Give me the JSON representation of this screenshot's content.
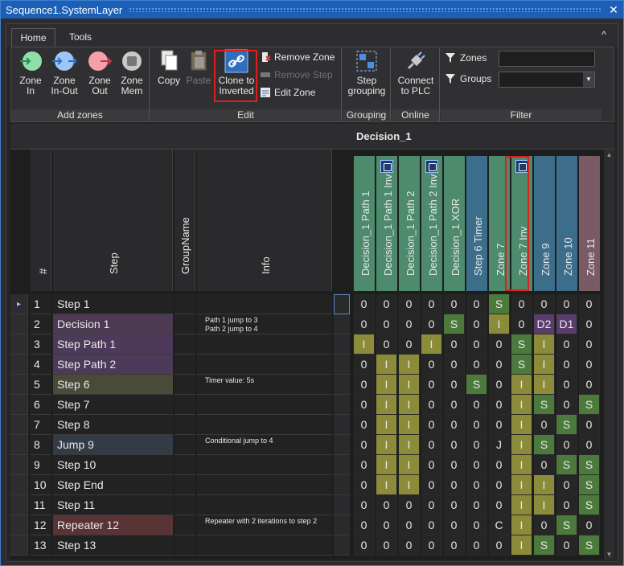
{
  "window": {
    "title": "Sequence1.SystemLayer"
  },
  "tabs": [
    {
      "label": "Home"
    },
    {
      "label": "Tools"
    }
  ],
  "ribbon": {
    "add_zones": {
      "title": "Add zones",
      "buttons": [
        {
          "label": "Zone\nIn",
          "color": "#3cb371"
        },
        {
          "label": "Zone\nIn-Out",
          "color": "#4a90e2"
        },
        {
          "label": "Zone\nOut",
          "color": "#e85d6a"
        },
        {
          "label": "Zone\nMem",
          "color": "#a0a0a0"
        }
      ]
    },
    "edit": {
      "title": "Edit",
      "copy": "Copy",
      "paste": "Paste",
      "clone": "Clone to\nInverted",
      "remove_zone": "Remove Zone",
      "remove_step": "Remove Step",
      "edit_zone": "Edit Zone"
    },
    "grouping": {
      "title": "Grouping",
      "step_grouping": "Step\ngrouping"
    },
    "online": {
      "title": "Online",
      "connect": "Connect\nto PLC"
    },
    "filter": {
      "title": "Filter",
      "zones_label": "Zones",
      "groups_label": "Groups",
      "zones_value": "",
      "groups_value": ""
    }
  },
  "grid": {
    "group_label": "Decision_1",
    "columns": {
      "num": "#",
      "step": "Step",
      "groupname": "GroupName",
      "info": "Info"
    },
    "zones": [
      {
        "name": "Decision_1 Path 1",
        "color": "#4e8a6c",
        "inv": false
      },
      {
        "name": "Decision_1 Path 1 Inv",
        "color": "#4e8a6c",
        "inv": true
      },
      {
        "name": "Decision_1 Path 2",
        "color": "#4e8a6c",
        "inv": false
      },
      {
        "name": "Decision_1 Path 2 Inv",
        "color": "#4e8a6c",
        "inv": true
      },
      {
        "name": "Decision_1 XOR",
        "color": "#4e8a6c",
        "inv": false
      },
      {
        "name": "Step 6 Timer",
        "color": "#3c6e8c",
        "inv": false
      },
      {
        "name": "Zone 7",
        "color": "#4e8a6c",
        "inv": false
      },
      {
        "name": "Zone 7 Inv",
        "color": "#4e8a6c",
        "inv": true
      },
      {
        "name": "Zone 9",
        "color": "#3c6e8c",
        "inv": false
      },
      {
        "name": "Zone 10",
        "color": "#3c6e8c",
        "inv": false
      },
      {
        "name": "Zone 11",
        "color": "#7a5a64",
        "inv": false
      }
    ],
    "rows": [
      {
        "num": "1",
        "step": "Step 1",
        "info": "",
        "color": "",
        "cells": [
          "0",
          "0",
          "0",
          "0",
          "0",
          "0",
          "S",
          "0",
          "0",
          "0",
          "0"
        ]
      },
      {
        "num": "2",
        "step": "Decision 1",
        "info": "Path 1 jump to 3\nPath 2 jump to 4",
        "color": "#4d3a52",
        "cells": [
          "0",
          "0",
          "0",
          "0",
          "S",
          "0",
          "I",
          "0",
          "D2",
          "D1",
          "0"
        ]
      },
      {
        "num": "3",
        "step": "Step Path 1",
        "info": "",
        "color": "#4d3a5a",
        "cells": [
          "I",
          "0",
          "0",
          "I",
          "0",
          "0",
          "0",
          "S",
          "I",
          "0",
          "0"
        ]
      },
      {
        "num": "4",
        "step": "Step Path 2",
        "info": "",
        "color": "#4d3a5a",
        "cells": [
          "0",
          "I",
          "I",
          "0",
          "0",
          "0",
          "0",
          "S",
          "I",
          "0",
          "0"
        ]
      },
      {
        "num": "5",
        "step": "Step 6",
        "info": "Timer value: 5s",
        "color": "#4a4a3a",
        "cells": [
          "0",
          "I",
          "I",
          "0",
          "0",
          "S",
          "0",
          "I",
          "I",
          "0",
          "0"
        ]
      },
      {
        "num": "6",
        "step": "Step 7",
        "info": "",
        "color": "",
        "cells": [
          "0",
          "I",
          "I",
          "0",
          "0",
          "0",
          "0",
          "I",
          "S",
          "0",
          "S"
        ]
      },
      {
        "num": "7",
        "step": "Step 8",
        "info": "",
        "color": "",
        "cells": [
          "0",
          "I",
          "I",
          "0",
          "0",
          "0",
          "0",
          "I",
          "0",
          "S",
          "0"
        ]
      },
      {
        "num": "8",
        "step": "Jump 9",
        "info": "Conditional jump to 4",
        "color": "#333b47",
        "cells": [
          "0",
          "I",
          "I",
          "0",
          "0",
          "0",
          "J",
          "I",
          "S",
          "0",
          "0"
        ]
      },
      {
        "num": "9",
        "step": "Step 10",
        "info": "",
        "color": "",
        "cells": [
          "0",
          "I",
          "I",
          "0",
          "0",
          "0",
          "0",
          "I",
          "0",
          "S",
          "S"
        ]
      },
      {
        "num": "10",
        "step": "Step End",
        "info": "",
        "color": "",
        "cells": [
          "0",
          "I",
          "I",
          "0",
          "0",
          "0",
          "0",
          "I",
          "I",
          "0",
          "S"
        ]
      },
      {
        "num": "11",
        "step": "Step 11",
        "info": "",
        "color": "",
        "cells": [
          "0",
          "0",
          "0",
          "0",
          "0",
          "0",
          "0",
          "I",
          "I",
          "0",
          "S"
        ]
      },
      {
        "num": "12",
        "step": "Repeater 12",
        "info": "Repeater with 2 iterations to step 2",
        "color": "#5a3434",
        "cells": [
          "0",
          "0",
          "0",
          "0",
          "0",
          "0",
          "C",
          "I",
          "0",
          "S",
          "0"
        ]
      },
      {
        "num": "13",
        "step": "Step 13",
        "info": "",
        "color": "",
        "cells": [
          "0",
          "0",
          "0",
          "0",
          "0",
          "0",
          "0",
          "I",
          "S",
          "0",
          "S"
        ]
      }
    ],
    "cell_colors": {
      "0": "#262626",
      "I": "#8b8b3a",
      "S": "#4c7a3c",
      "D1": "#5a3d6e",
      "D2": "#5a3d6e",
      "J": "#262626",
      "C": "#262626"
    }
  }
}
